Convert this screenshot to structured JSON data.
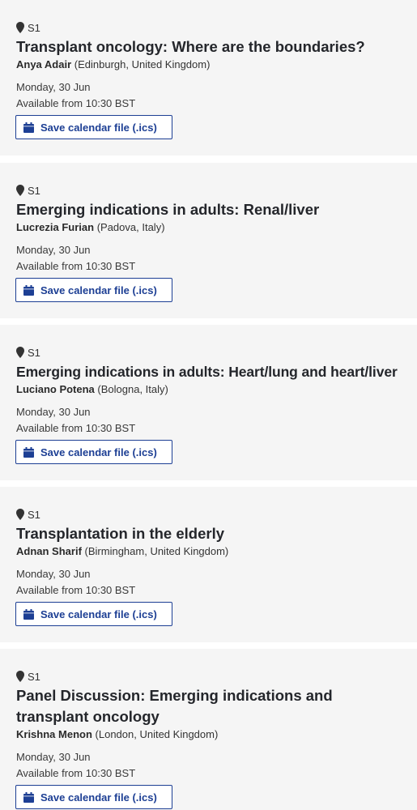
{
  "sessions": [
    {
      "room": "S1",
      "title": "Transplant oncology: Where are the boundaries?",
      "speaker_name": "Anya Adair",
      "speaker_location": "(Edinburgh, United Kingdom)",
      "date": "Monday, 30 Jun",
      "availability": "Available from 10:30 BST",
      "button_label": "Save calendar file (.ics)"
    },
    {
      "room": "S1",
      "title": "Emerging indications in adults: Renal/liver",
      "speaker_name": "Lucrezia Furian",
      "speaker_location": "(Padova, Italy)",
      "date": "Monday, 30 Jun",
      "availability": "Available from 10:30 BST",
      "button_label": "Save calendar file (.ics)"
    },
    {
      "room": "S1",
      "title": "Emerging indications in adults: Heart/lung and heart/liver",
      "speaker_name": "Luciano Potena",
      "speaker_location": "(Bologna, Italy)",
      "date": "Monday, 30 Jun",
      "availability": "Available from 10:30 BST",
      "button_label": "Save calendar file (.ics)"
    },
    {
      "room": "S1",
      "title": "Transplantation in the elderly",
      "speaker_name": "Adnan Sharif",
      "speaker_location": "(Birmingham, United Kingdom)",
      "date": "Monday, 30 Jun",
      "availability": "Available from 10:30 BST",
      "button_label": "Save calendar file (.ics)"
    },
    {
      "room": "S1",
      "title": "Panel Discussion: Emerging indications and transplant oncology",
      "speaker_name": "Krishna Menon",
      "speaker_location": "(London, United Kingdom)",
      "date": "Monday, 30 Jun",
      "availability": "Available from 10:30 BST",
      "button_label": "Save calendar file (.ics)"
    }
  ],
  "icons": {
    "location": "map-pin-icon",
    "calendar": "calendar-icon"
  },
  "colors": {
    "card_background": "#f5f5f5",
    "accent": "#1d3f94",
    "title_text": "#24262b"
  }
}
